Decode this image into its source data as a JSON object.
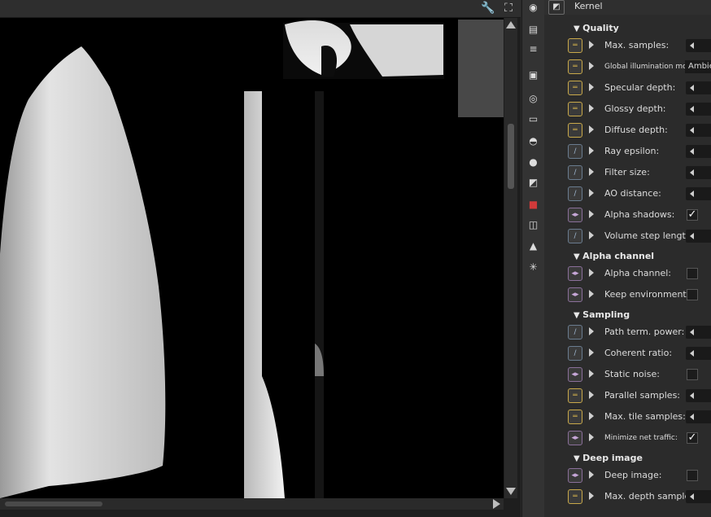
{
  "panel": {
    "title": "Kernel",
    "sections": [
      {
        "title": "Quality",
        "rows": [
          {
            "label": "Max. samples:",
            "control": "stepper",
            "pin": "float"
          },
          {
            "label": "Global illumination mode:",
            "control": "dropdown",
            "value": "Ambient occlusion",
            "pin": "float"
          },
          {
            "label": "Specular depth:",
            "control": "stepper",
            "pin": "float"
          },
          {
            "label": "Glossy depth:",
            "control": "stepper",
            "pin": "float"
          },
          {
            "label": "Diffuse depth:",
            "control": "stepper",
            "pin": "float"
          },
          {
            "label": "Ray epsilon:",
            "control": "stepper",
            "pin": "curve"
          },
          {
            "label": "Filter size:",
            "control": "stepper",
            "pin": "curve"
          },
          {
            "label": "AO distance:",
            "control": "stepper",
            "pin": "curve"
          },
          {
            "label": "Alpha shadows:",
            "control": "checkbox",
            "checked": true,
            "pin": "bool"
          },
          {
            "label": "Volume step length:",
            "control": "stepper",
            "pin": "curve"
          }
        ]
      },
      {
        "title": "Alpha channel",
        "rows": [
          {
            "label": "Alpha channel:",
            "control": "checkbox",
            "checked": false,
            "pin": "bool"
          },
          {
            "label": "Keep environment:",
            "control": "checkbox",
            "checked": false,
            "pin": "bool"
          }
        ]
      },
      {
        "title": "Sampling",
        "rows": [
          {
            "label": "Path term. power:",
            "control": "stepper",
            "pin": "curve"
          },
          {
            "label": "Coherent ratio:",
            "control": "stepper",
            "pin": "curve"
          },
          {
            "label": "Static noise:",
            "control": "checkbox",
            "checked": false,
            "pin": "bool"
          },
          {
            "label": "Parallel samples:",
            "control": "stepper",
            "pin": "float"
          },
          {
            "label": "Max. tile samples:",
            "control": "stepper",
            "pin": "float"
          },
          {
            "label": "Minimize net traffic:",
            "control": "checkbox",
            "checked": true,
            "pin": "bool"
          }
        ]
      },
      {
        "title": "Deep image",
        "rows": [
          {
            "label": "Deep image:",
            "control": "checkbox",
            "checked": false,
            "pin": "bool"
          },
          {
            "label": "Max. depth samples:",
            "control": "stepper",
            "pin": "float"
          }
        ]
      }
    ]
  },
  "icons": {
    "toolbar": [
      "wrench-icon",
      "fullscreen-icon"
    ],
    "strip": [
      "render-target-icon",
      "kernel-settings-icon",
      "layers-icon",
      "list-icon",
      "image-icon",
      "camera-icon",
      "monitor-icon",
      "database-icon",
      "material-icon",
      "node-icon",
      "texture-icon",
      "layers-stack-icon",
      "picture-icon",
      "sun-icon"
    ]
  },
  "glyphs": {
    "wrench": "🔧",
    "fullscreen": "⛶",
    "check": "✓",
    "float_pin": "═",
    "curve_pin": "∕",
    "bool_pin": "◂▸",
    "kernel": "◩"
  },
  "colors": {
    "accent_float": "#c9a94a",
    "accent_curve": "#6a7c8f",
    "accent_bool": "#8a6f9a"
  }
}
